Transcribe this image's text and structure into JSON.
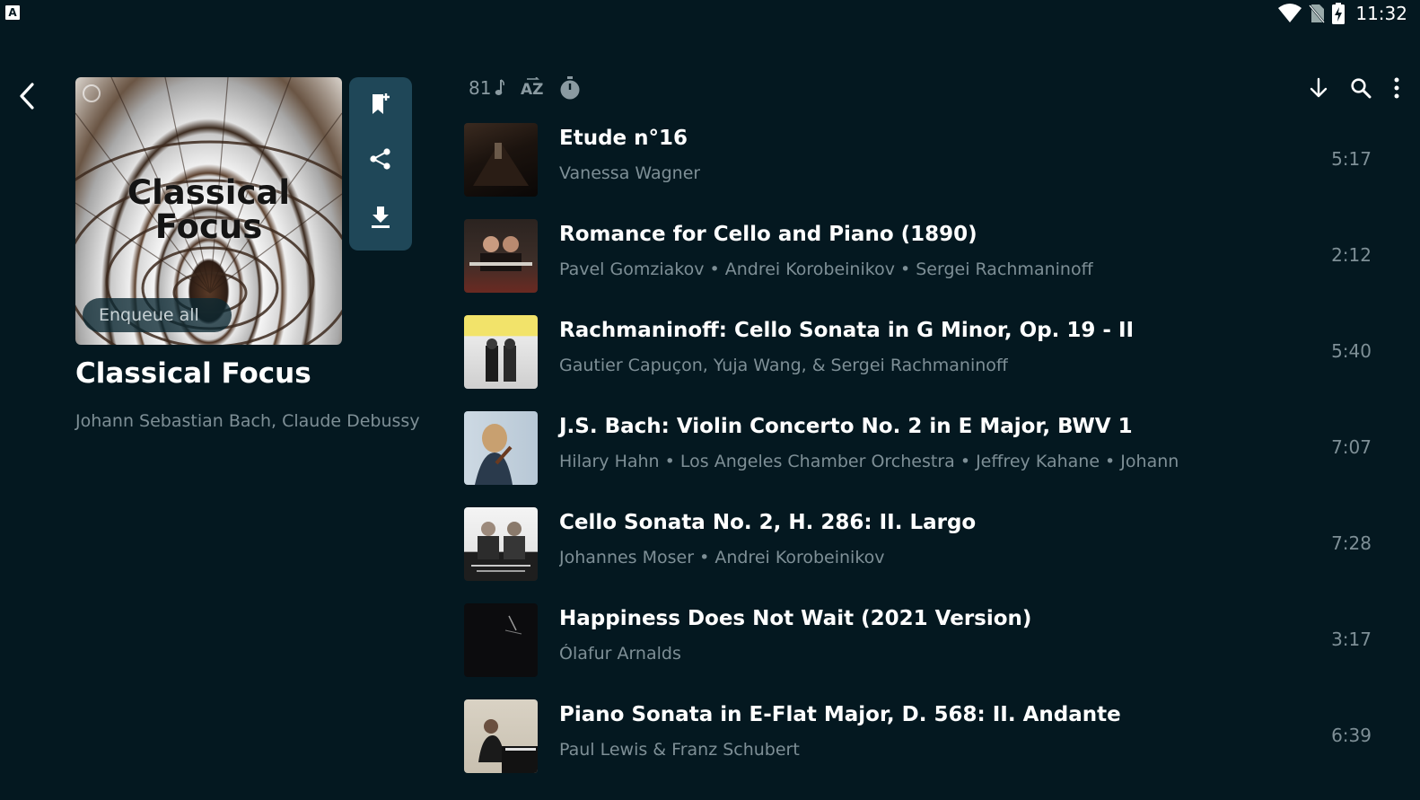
{
  "status_bar": {
    "time": "11:32",
    "app_badge": "A"
  },
  "header": {
    "back_icon": "chevron-left-icon",
    "track_count": "81",
    "sort_icon": "sort-az-icon",
    "timer_icon": "timer-icon",
    "download_icon": "arrow-down-icon",
    "search_icon": "search-icon",
    "menu_icon": "more-vert-icon"
  },
  "playlist": {
    "cover_text": "Classical Focus",
    "enqueue_label": "Enqueue all",
    "title": "Classical Focus",
    "artists": "Johann Sebastian Bach, Claude Debussy"
  },
  "actions": [
    "bookmark-add-icon",
    "share-icon",
    "download-icon"
  ],
  "tracks": [
    {
      "title": "Etude n°16",
      "artist": "Vanessa Wagner",
      "duration": "5:17"
    },
    {
      "title": "Romance for Cello and Piano (1890)",
      "artist": "Pavel Gomziakov • Andrei Korobeinikov • Sergei Rachmaninoff",
      "duration": "2:12"
    },
    {
      "title": "Rachmaninoff: Cello Sonata in G Minor, Op. 19 - II",
      "artist": "Gautier Capuçon, Yuja Wang, & Sergei Rachmaninoff",
      "duration": "5:40"
    },
    {
      "title": "J.S. Bach: Violin Concerto No. 2 in E Major, BWV 1",
      "artist": "Hilary Hahn • Los Angeles Chamber Orchestra • Jeffrey Kahane • Johann",
      "duration": "7:07"
    },
    {
      "title": "Cello Sonata No. 2, H. 286: II. Largo",
      "artist": "Johannes Moser • Andrei Korobeinikov",
      "duration": "7:28"
    },
    {
      "title": "Happiness Does Not Wait (2021 Version)",
      "artist": "Ólafur Arnalds",
      "duration": "3:17"
    },
    {
      "title": "Piano Sonata in E-Flat Major, D. 568: II. Andante",
      "artist": "Paul Lewis & Franz Schubert",
      "duration": "6:39"
    }
  ],
  "colors": {
    "background": "#041820",
    "pill": "#1f4758",
    "muted_text": "#7e8f96"
  }
}
